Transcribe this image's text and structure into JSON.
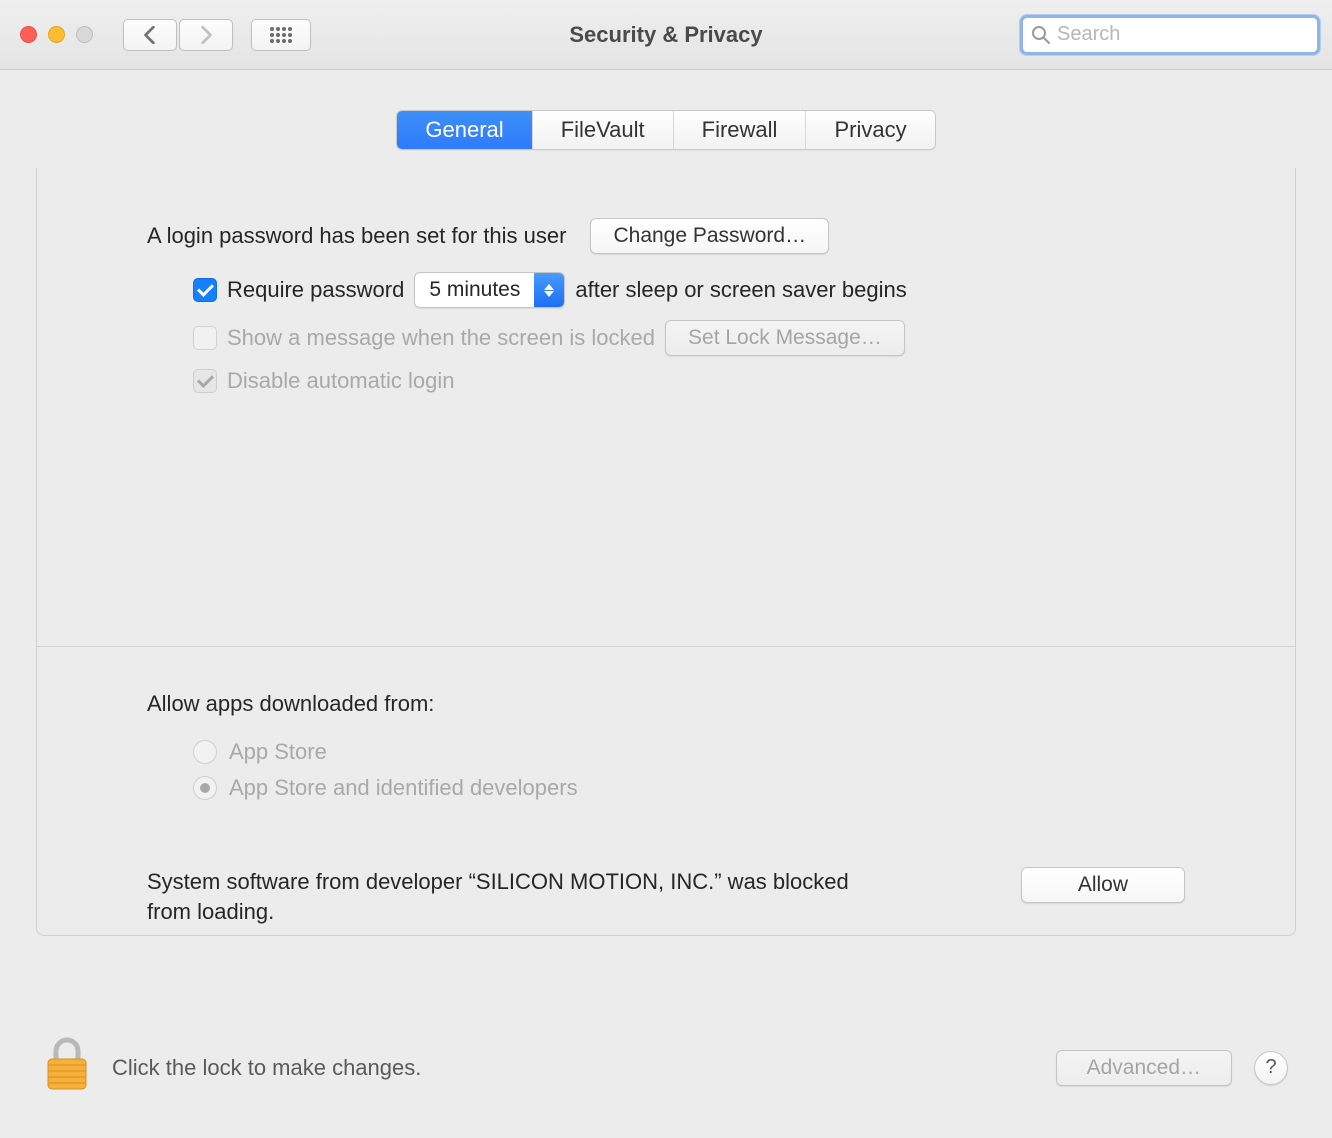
{
  "header": {
    "title": "Security & Privacy",
    "search_placeholder": "Search"
  },
  "tabs": {
    "general": "General",
    "filevault": "FileVault",
    "firewall": "Firewall",
    "privacy": "Privacy"
  },
  "login": {
    "label": "A login password has been set for this user",
    "change_btn": "Change Password…"
  },
  "require_pw": {
    "label_before": "Require password",
    "select": "5 minutes",
    "label_after": "after sleep or screen saver begins"
  },
  "show_msg": {
    "label": "Show a message when the screen is locked",
    "btn": "Set Lock Message…"
  },
  "disable_auto": {
    "label": "Disable automatic login"
  },
  "allow_apps": {
    "header": "Allow apps downloaded from:",
    "opt1": "App Store",
    "opt2": "App Store and identified developers"
  },
  "blocked": {
    "text": "System software from developer “SILICON MOTION, INC.” was blocked from loading.",
    "btn": "Allow"
  },
  "footer": {
    "text": "Click the lock to make changes.",
    "advanced": "Advanced…",
    "help": "?"
  }
}
